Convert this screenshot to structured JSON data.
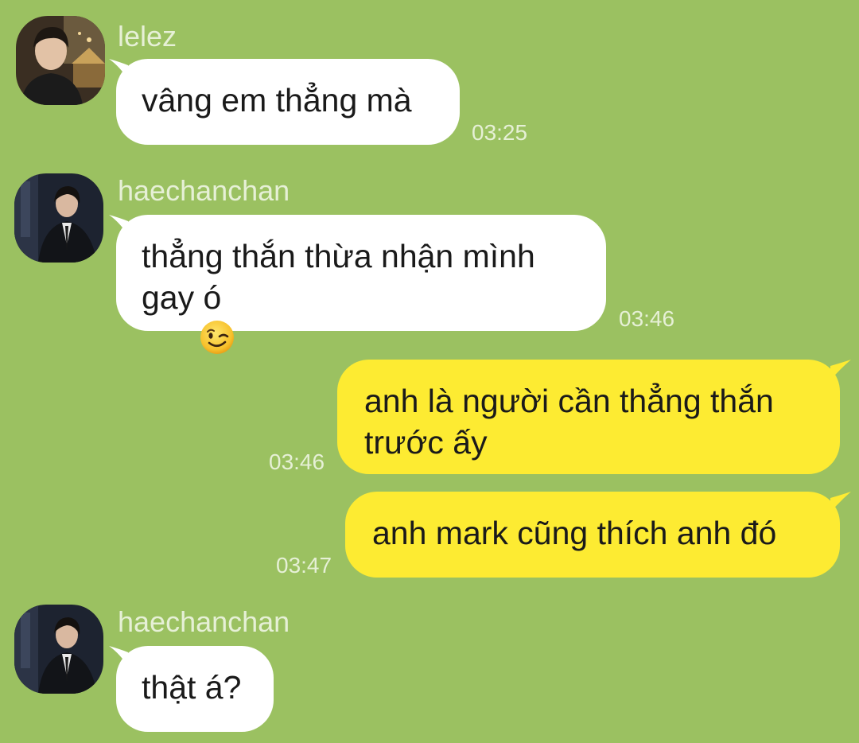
{
  "messages": [
    {
      "sender": "lelez",
      "text": "vâng em thẳng mà",
      "time": "03:25",
      "direction": "incoming",
      "avatar": "avatar-lelez"
    },
    {
      "sender": "haechanchan",
      "text_line1": "thẳng thắn thừa nhận mình",
      "text_line2": "gay ó",
      "emoji": "winking-face-emoji",
      "time": "03:46",
      "direction": "incoming",
      "avatar": "avatar-haechanchan"
    },
    {
      "text_line1": "anh là người cần thẳng thắn",
      "text_line2": "trước ấy",
      "time": "03:46",
      "direction": "outgoing"
    },
    {
      "text": "anh mark cũng thích anh đó",
      "time": "03:47",
      "direction": "outgoing"
    },
    {
      "sender": "haechanchan",
      "text": "thật á?",
      "direction": "incoming",
      "avatar": "avatar-haechanchan"
    }
  ],
  "colors": {
    "background": "#9bc161",
    "incoming_bubble": "#ffffff",
    "outgoing_bubble": "#fdeb32",
    "meta_text": "#e6f0d6"
  }
}
